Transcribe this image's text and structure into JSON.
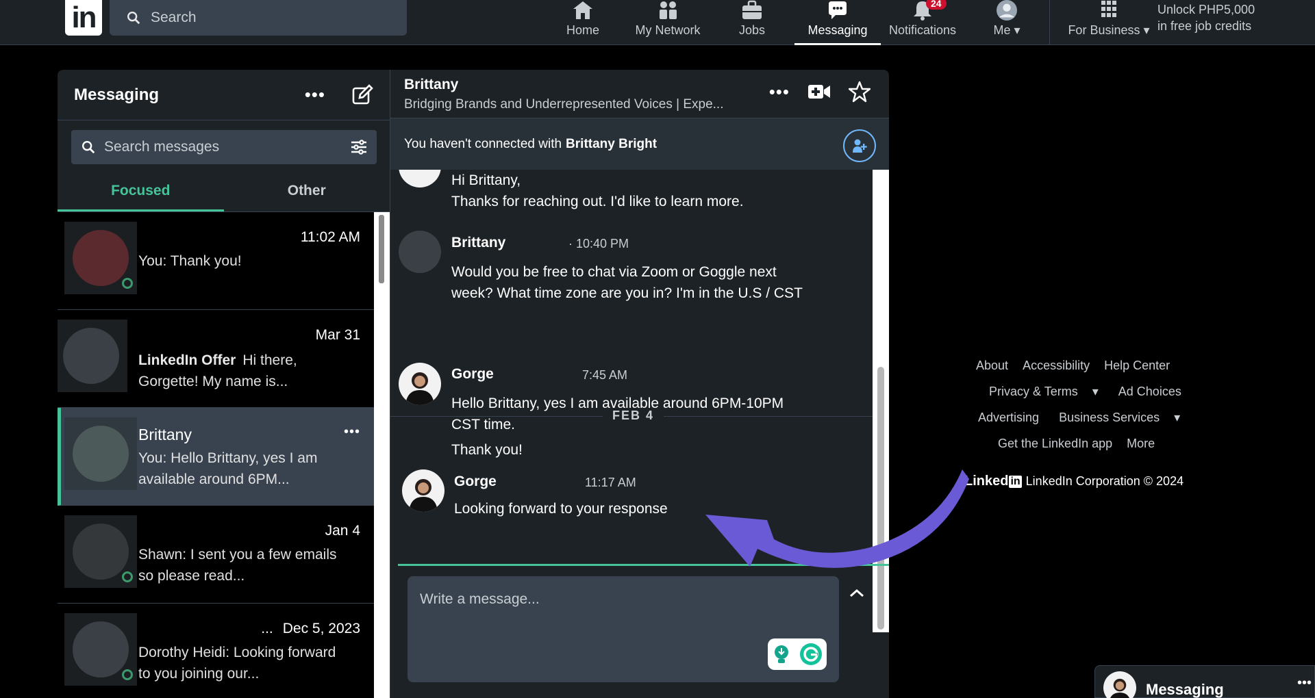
{
  "nav": {
    "search_placeholder": "Search",
    "items": [
      {
        "label": "Home"
      },
      {
        "label": "My Network"
      },
      {
        "label": "Jobs"
      },
      {
        "label": "Messaging"
      },
      {
        "label": "Notifications",
        "badge": "24"
      },
      {
        "label": "Me"
      },
      {
        "label": "For Business"
      }
    ],
    "promo_line1": "Unlock PHP5,000",
    "promo_line2": "in free job credits"
  },
  "sidebar": {
    "title": "Messaging",
    "search_placeholder": "Search messages",
    "tabs": [
      {
        "label": "Focused"
      },
      {
        "label": "Other"
      }
    ],
    "conversations": [
      {
        "time": "11:02 AM",
        "snippet": "You: Thank you!"
      },
      {
        "time": "Mar 31",
        "snippet_bold": "LinkedIn Offer",
        "snippet": "Hi there, Gorgette! My name is..."
      },
      {
        "name": "Brittany",
        "snippet": "You: Hello Brittany, yes I am available around 6PM..."
      },
      {
        "time": "Jan 4",
        "snippet": "Shawn: I sent you a few emails so please read..."
      },
      {
        "time": "Dec 5, 2023",
        "prefix": "...",
        "snippet": "Dorothy Heidi: Looking forward to you joining our..."
      }
    ]
  },
  "chat": {
    "name": "Brittany",
    "headline": "Bridging Brands and Underrepresented Voices | Expe...",
    "banner_prefix": "You haven't connected with",
    "banner_name": "Brittany Bright",
    "messages": [
      {
        "line1": "Hi Brittany,",
        "line2": "Thanks for reaching out. I'd like to learn more."
      },
      {
        "sender": "Brittany",
        "time": "10:40 PM",
        "text": "Would you be free to chat via Zoom or Goggle next week? What time zone are you in? I'm in the U.S / CST"
      },
      {
        "sender": "Gorge",
        "time": "7:45 AM",
        "text": "Hello Brittany, yes I am available around 6PM-10PM CST time.",
        "text2": "Thank you!"
      },
      {
        "sender": "Gorge",
        "time": "11:17 AM",
        "text": "Looking forward to your response"
      }
    ],
    "date_separator": "FEB 4",
    "compose_placeholder": "Write a message..."
  },
  "footer": {
    "links": [
      "About",
      "Accessibility",
      "Help Center",
      "Privacy & Terms",
      "Ad Choices",
      "Advertising",
      "Business Services",
      "Get the LinkedIn app",
      "More"
    ],
    "brand_word": "Linked",
    "brand_box": "in",
    "copyright": "LinkedIn Corporation © 2024"
  },
  "mini_messaging": {
    "title": "Messaging"
  },
  "colors": {
    "accent_green": "#45c49a",
    "annotation_arrow": "#6b5ad6",
    "badge_red": "#cb112d"
  }
}
